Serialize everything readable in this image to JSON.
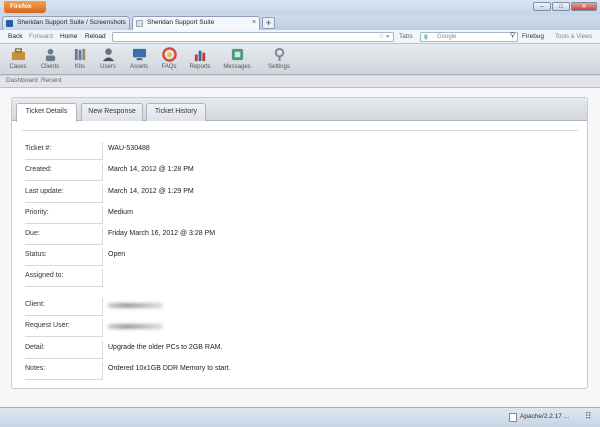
{
  "window": {
    "app_button": "Firefox",
    "controls": [
      "–",
      "□",
      "✕"
    ]
  },
  "tabs": [
    {
      "label": "Sheridan Support Suite / Screenshots",
      "active": false
    },
    {
      "label": "Sheridan Support Suite",
      "active": true
    }
  ],
  "tab_close_glyph": "×",
  "new_tab_glyph": "+",
  "nav": {
    "back": "Back",
    "forward": "Forward",
    "home": "Home",
    "reload": "Reload",
    "tabs": "Tabs",
    "search_placeholder": "Google",
    "search_engine_glyph": "g",
    "firebug": "Firebug",
    "tools": "Tools & Views"
  },
  "app_toolbar": [
    {
      "label": "Cases",
      "icon": "briefcase-icon",
      "color": "#c8903a"
    },
    {
      "label": "Clients",
      "icon": "clients-icon",
      "color": "#6a7a8c"
    },
    {
      "label": "Kbs",
      "icon": "books-icon",
      "color": "#8a6a9c"
    },
    {
      "label": "Users",
      "icon": "user-icon",
      "color": "#6b7380"
    },
    {
      "label": "Assets",
      "icon": "computer-icon",
      "color": "#3a6ea8"
    },
    {
      "label": "FAQs",
      "icon": "faq-icon",
      "color": "#d24a3a"
    },
    {
      "label": "Reports",
      "icon": "reports-icon",
      "color": "#c0392b"
    },
    {
      "label": "Messages",
      "icon": "messages-icon",
      "color": "#4a9a7a"
    },
    {
      "label": "Settings",
      "icon": "settings-icon",
      "color": "#7a8796"
    }
  ],
  "subnav": {
    "dashboard": "Dashboard",
    "recent": "Recent"
  },
  "panel_tabs": [
    {
      "label": "Ticket Details",
      "active": true
    },
    {
      "label": "New Response",
      "active": false
    },
    {
      "label": "Ticket History",
      "active": false
    }
  ],
  "ticket": {
    "fields": [
      {
        "label": "Ticket #:",
        "value": "WAU-530488"
      },
      {
        "label": "Created:",
        "value": "March 14, 2012 @ 1:28 PM"
      },
      {
        "label": "Last update:",
        "value": "March 14, 2012 @ 1:29 PM"
      },
      {
        "label": "Priority:",
        "value": "Medium"
      },
      {
        "label": "Due:",
        "value": "Friday March 16, 2012 @ 3:28 PM"
      },
      {
        "label": "Status:",
        "value": "Open"
      },
      {
        "label": "Assigned to:",
        "value": ""
      },
      {
        "label": "Client:",
        "value": "",
        "redacted": true
      },
      {
        "label": "Request User:",
        "value": "",
        "redacted": true
      },
      {
        "label": "Detail:",
        "value": "Upgrade the older PCs to 2GB RAM."
      },
      {
        "label": "Notes:",
        "value": "Ordered 10x1GB DDR Memory to start."
      }
    ]
  },
  "statusbar": {
    "server": "Apache/2.2.17 ...",
    "end_glyph": "⠿"
  }
}
